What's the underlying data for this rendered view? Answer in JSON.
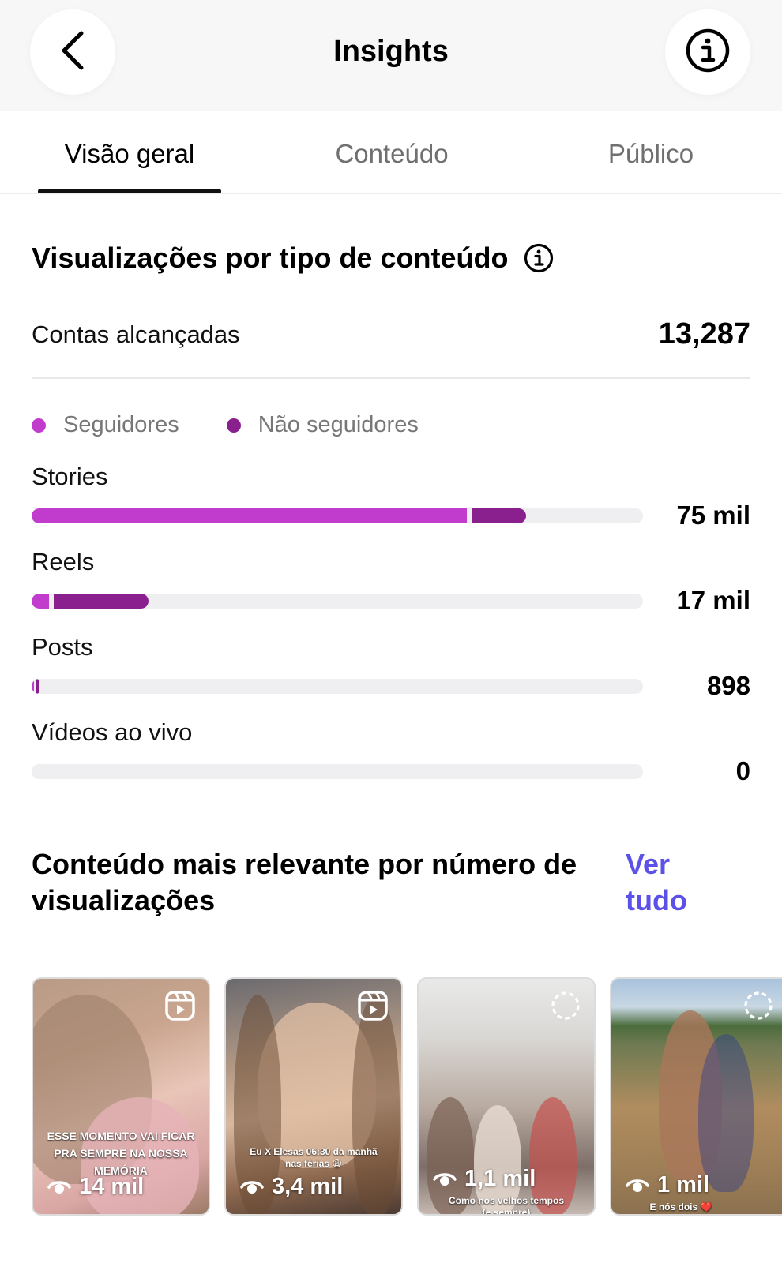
{
  "header": {
    "title": "Insights",
    "back_icon": "chevron-left-icon",
    "info_icon": "info-icon"
  },
  "tabs": [
    {
      "label": "Visão geral",
      "active": true
    },
    {
      "label": "Conteúdo",
      "active": false
    },
    {
      "label": "Público",
      "active": false
    }
  ],
  "views_section": {
    "title": "Visualizações por tipo de conteúdo",
    "reach_label": "Contas alcançadas",
    "reach_value": "13,287",
    "legend": [
      {
        "label": "Seguidores",
        "color": "#c13bcc"
      },
      {
        "label": "Não seguidores",
        "color": "#8a1f8e"
      }
    ],
    "rows": [
      {
        "label": "Stories",
        "value": "75 mil",
        "followers_fraction": 0.712,
        "non_followers_fraction": 0.0894
      },
      {
        "label": "Reels",
        "value": "17 mil",
        "followers_fraction": 0.028,
        "non_followers_fraction": 0.155
      },
      {
        "label": "Posts",
        "value": "898",
        "followers_fraction": 0.0045,
        "non_followers_fraction": 0.0045
      },
      {
        "label": "Vídeos ao vivo",
        "value": "0",
        "followers_fraction": 0,
        "non_followers_fraction": 0
      }
    ]
  },
  "top_content": {
    "title": "Conteúdo mais relevante por número de visualizações",
    "see_all": "Ver tudo",
    "items": [
      {
        "views": "14 mil",
        "type_icon": "reel-icon",
        "caption_lines": [
          "ESSE MOMENTO VAI FICAR",
          "PRA SEMPRE NA NOSSA MEMÓRIA"
        ]
      },
      {
        "views": "3,4 mil",
        "type_icon": "reel-icon",
        "caption_lines": [
          "Eu X Elesas 06:30 da manhã",
          "nas férias 😩"
        ]
      },
      {
        "views": "1,1 mil",
        "type_icon": "story-icon",
        "caption_lines": [
          "Como nos velhos tempos",
          "(e sempre)"
        ]
      },
      {
        "views": "1 mil",
        "type_icon": "story-icon",
        "caption_lines": [
          "E nós dois ❤️"
        ]
      }
    ]
  },
  "colors": {
    "followers": "#c13bcc",
    "non_followers": "#8a1f8e",
    "track": "#efeff2",
    "link": "#5b51e8"
  }
}
